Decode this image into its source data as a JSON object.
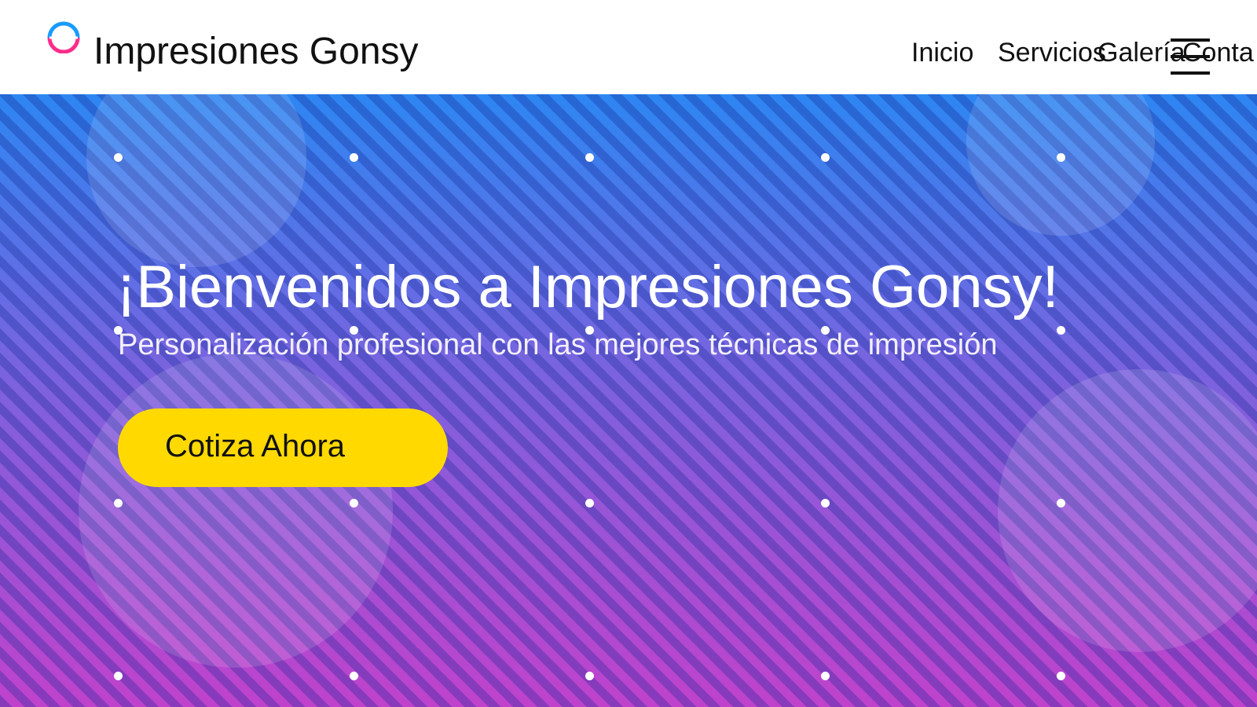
{
  "header": {
    "brand": "Impresiones Gonsy",
    "logo_icon": "ring-logo-icon",
    "nav": [
      "Inicio",
      "Servicios",
      "Galería",
      "Conta"
    ],
    "menu_icon": "hamburger-menu-icon"
  },
  "hero": {
    "title": "¡Bienvenidos a Impresiones Gonsy!",
    "subtitle": "Personalización profesional con las mejores técnicas de impresión",
    "cta_label": "Cotiza Ahora"
  },
  "colors": {
    "hero_top": "#2d86f2",
    "hero_bottom": "#c042cc",
    "cta": "#ffd900",
    "logo_cyan": "#1a9bff",
    "logo_pink": "#ff2d8a"
  }
}
